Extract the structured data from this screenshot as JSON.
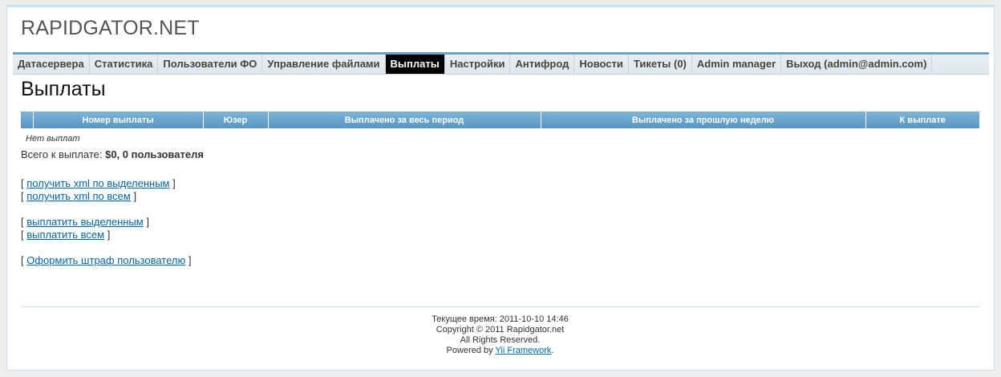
{
  "header": {
    "logo": "RAPIDGATOR.NET"
  },
  "menu": {
    "items": [
      {
        "label": "Датасервера"
      },
      {
        "label": "Статистика"
      },
      {
        "label": "Пользователи ФО"
      },
      {
        "label": "Управление файлами"
      },
      {
        "label": "Выплаты",
        "active": true
      },
      {
        "label": "Настройки"
      },
      {
        "label": "Антифрод"
      },
      {
        "label": "Новости"
      },
      {
        "label": "Тикеты (0)"
      },
      {
        "label": "Admin manager"
      },
      {
        "label": "Выход (admin@admin.com)"
      }
    ]
  },
  "main": {
    "title": "Выплаты",
    "table": {
      "columns": [
        "",
        "Номер выплаты",
        "Юзер",
        "Выплачено за весь период",
        "Выплачено за прошлую неделю",
        "К выплате"
      ],
      "empty_text": "Нет выплат"
    },
    "total": {
      "label": "Всего к выплате:",
      "value": "$0, 0 пользователя"
    },
    "actions": {
      "xml_selected": "получить xml по выделенным",
      "xml_all": "получить xml по всем",
      "pay_selected": "выплатить выделенным",
      "pay_all": "выплатить всем",
      "fine_user": "Оформить штраф пользователю",
      "bracket_open": "[",
      "bracket_close": "]"
    }
  },
  "footer": {
    "time": "Текущее время: 2011-10-10 14:46",
    "copyright": "Copyright © 2011 Rapidgator.net",
    "rights": "All Rights Reserved.",
    "powered_prefix": "Powered by",
    "powered_link": "Yii Framework",
    "powered_suffix": "."
  },
  "colors": {
    "menu_border": "#6ea1c6",
    "table_header": "#5797c4",
    "link": "#0066aa",
    "active_menu": "#000000"
  }
}
